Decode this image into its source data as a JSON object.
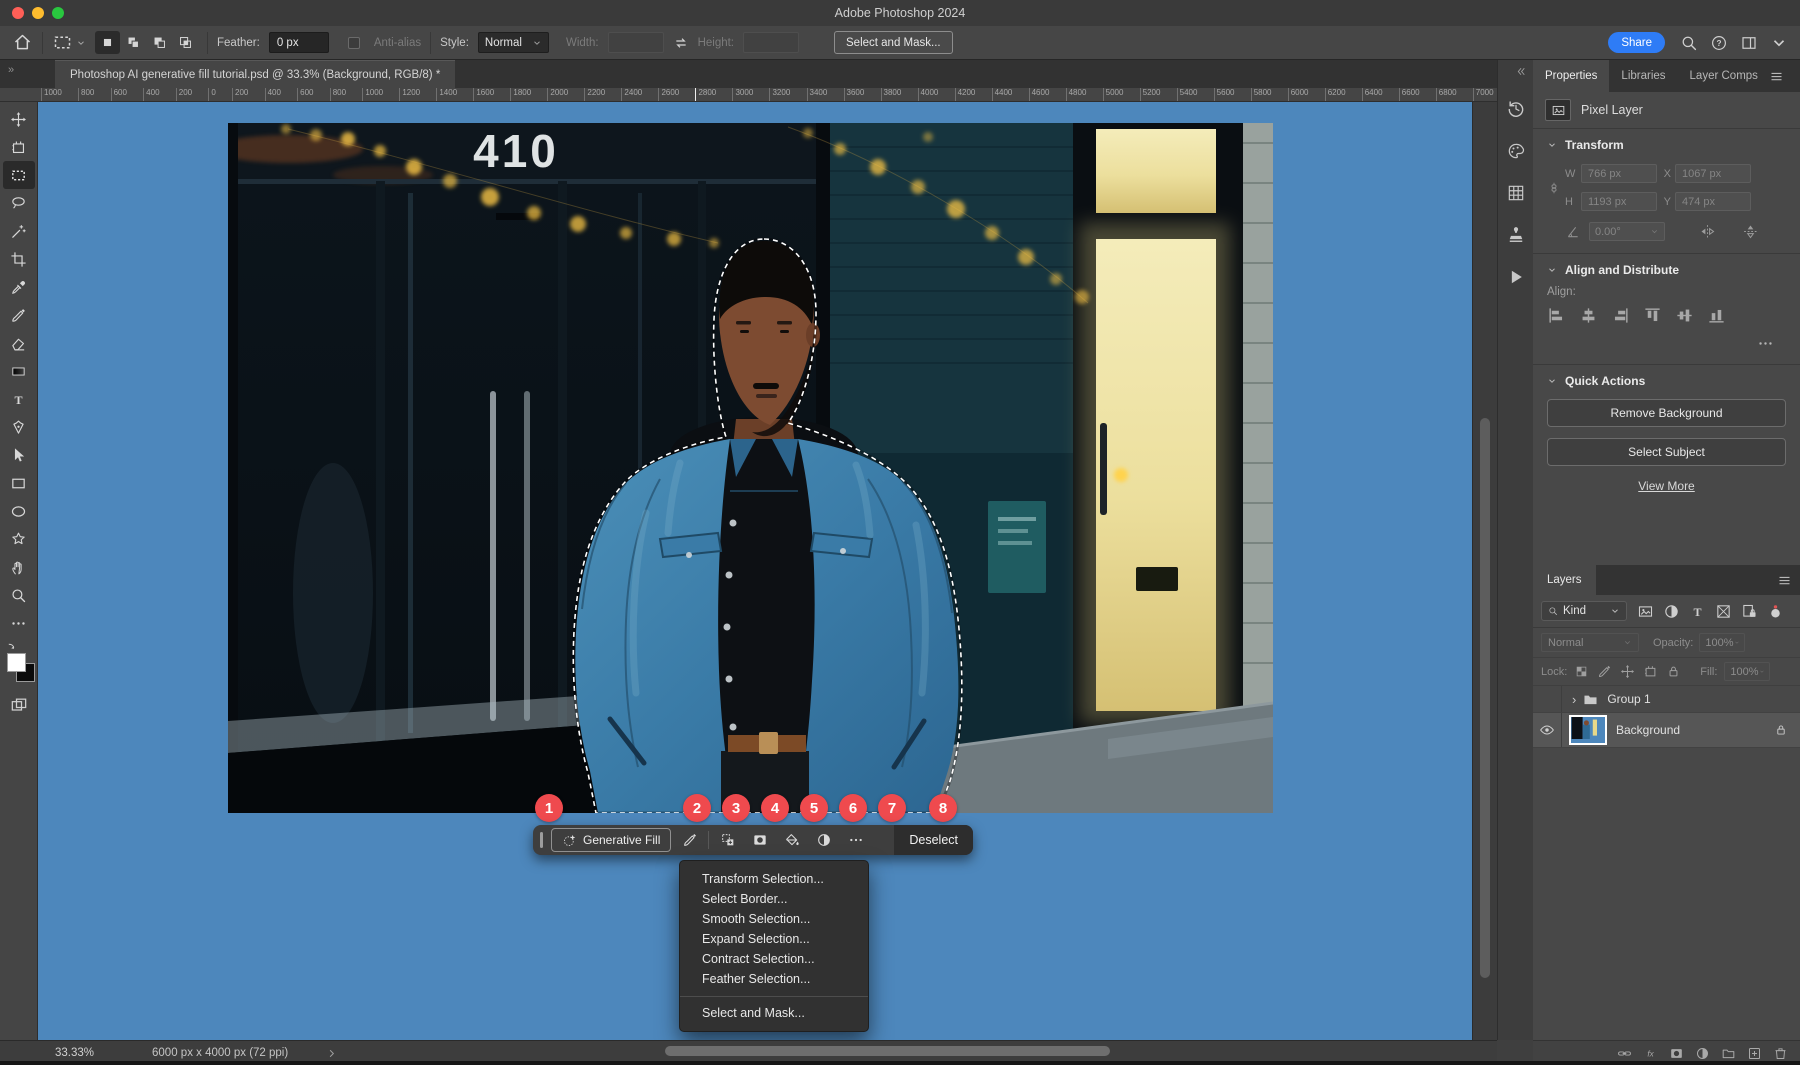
{
  "colors": {
    "canvas_blue": "#4d87bc",
    "badge_red": "#ef4a4e",
    "share_blue": "#2e7cf6"
  },
  "titlebar": {
    "title": "Adobe Photoshop 2024"
  },
  "options_bar": {
    "feather_label": "Feather:",
    "feather_value": "0 px",
    "antialias_label": "Anti-alias",
    "style_label": "Style:",
    "style_value": "Normal",
    "width_label": "Width:",
    "height_label": "Height:",
    "select_and_mask_label": "Select and Mask...",
    "share_label": "Share",
    "right_icons": [
      {
        "name": "search-icon",
        "icon": "#i-zoom"
      },
      {
        "name": "help-icon",
        "icon": "#i-help"
      },
      {
        "name": "workspace-icon",
        "icon": "#i-panel"
      },
      {
        "name": "chevron-down-icon",
        "icon": "#i-chevd"
      }
    ]
  },
  "document_tab": {
    "title": "Photoshop AI generative fill tutorial.psd @ 33.3% (Background, RGB/8) *",
    "overflow_indicator": "»"
  },
  "ruler_labels": [
    "1000",
    "800",
    "600",
    "400",
    "200",
    "0",
    "200",
    "400",
    "600",
    "800",
    "1000",
    "1200",
    "1400",
    "1600",
    "1800",
    "2000",
    "2200",
    "2400",
    "2600",
    "2800",
    "3000",
    "3200",
    "3400",
    "3600",
    "3800",
    "4000",
    "4200",
    "4400",
    "4600",
    "4800",
    "5000",
    "5200",
    "5400",
    "5600",
    "5800",
    "6000",
    "6200",
    "6400",
    "6600",
    "6800",
    "7000"
  ],
  "tools": [
    {
      "name": "move-tool",
      "icon": "#i-move"
    },
    {
      "name": "artboard-tool",
      "icon": "#i-artboard"
    },
    {
      "name": "rectangular-marquee-tool",
      "icon": "#i-marquee",
      "active": true
    },
    {
      "name": "lasso-tool",
      "icon": "#i-lasso"
    },
    {
      "name": "magic-wand-tool",
      "icon": "#i-wand"
    },
    {
      "name": "crop-tool",
      "icon": "#i-crop"
    },
    {
      "name": "eyedropper-tool",
      "icon": "#i-eyedrop"
    },
    {
      "name": "brush-tool",
      "icon": "#i-brush"
    },
    {
      "name": "eraser-tool",
      "icon": "#i-eraser"
    },
    {
      "name": "gradient-tool",
      "icon": "#i-gradient"
    },
    {
      "name": "type-tool",
      "icon": "#i-type"
    },
    {
      "name": "pen-tool",
      "icon": "#i-pen"
    },
    {
      "name": "path-selection-tool",
      "icon": "#i-arrow"
    },
    {
      "name": "rectangle-tool",
      "icon": "#i-rect"
    },
    {
      "name": "ellipse-tool",
      "icon": "#i-ellipse"
    },
    {
      "name": "custom-shape-tool",
      "icon": "#i-star"
    },
    {
      "name": "hand-tool",
      "icon": "#i-hand"
    },
    {
      "name": "zoom-tool",
      "icon": "#i-zoom"
    },
    {
      "name": "edit-toolbar-button",
      "icon": "#i-dots"
    }
  ],
  "canvas": {
    "sign_number": "410"
  },
  "task_bar": {
    "generative_fill_label": "Generative Fill",
    "deselect_label": "Deselect",
    "icons": [
      {
        "name": "modify-selection-icon",
        "icon": "#i-brush"
      },
      {
        "name": "invert-selection-icon",
        "icon": "#i-addsel"
      },
      {
        "name": "create-mask-icon",
        "icon": "#i-mask"
      },
      {
        "name": "fill-selection-icon",
        "icon": "#i-bucket"
      },
      {
        "name": "create-adjustment-icon",
        "icon": "#i-half"
      },
      {
        "name": "more-options-icon",
        "icon": "#i-dots"
      }
    ]
  },
  "badges": [
    "1",
    "2",
    "3",
    "4",
    "5",
    "6",
    "7",
    "8"
  ],
  "context_menu": {
    "items": [
      {
        "label": "Transform Selection..."
      },
      {
        "label": "Select Border..."
      },
      {
        "label": "Smooth Selection..."
      },
      {
        "label": "Expand Selection..."
      },
      {
        "label": "Contract Selection..."
      },
      {
        "label": "Feather Selection..."
      },
      {
        "label": "Select and Mask...",
        "cls": "divided"
      }
    ]
  },
  "status_bar": {
    "zoom_level": "33.33%",
    "doc_info": "6000 px x 4000 px (72 ppi)"
  },
  "collapsed_strip": {
    "icons": [
      {
        "name": "history-panel-icon",
        "icon": "#i-history"
      },
      {
        "name": "swatches-panel-icon",
        "icon": "#i-palette"
      },
      {
        "name": "patterns-panel-icon",
        "icon": "#i-grid"
      },
      {
        "name": "clone-source-panel-icon",
        "icon": "#i-stamp"
      },
      {
        "name": "actions-panel-icon",
        "icon": "#i-play"
      }
    ]
  },
  "properties_panel": {
    "tabs": [
      {
        "label": "Properties",
        "active": true
      },
      {
        "label": "Libraries"
      },
      {
        "label": "Layer Comps"
      }
    ],
    "layer_type": "Pixel Layer",
    "transform": {
      "title": "Transform",
      "w_label": "W",
      "w_value": "766 px",
      "x_label": "X",
      "x_value": "1067 px",
      "h_label": "H",
      "h_value": "1193 px",
      "y_label": "Y",
      "y_value": "474 px",
      "angle_value": "0.00°"
    },
    "align": {
      "title": "Align and Distribute",
      "align_label": "Align:",
      "icons": [
        {
          "name": "align-left-icon",
          "icon": "#i-al-l"
        },
        {
          "name": "align-center-h-icon",
          "icon": "#i-al-c"
        },
        {
          "name": "align-right-icon",
          "icon": "#i-al-r"
        },
        {
          "name": "align-top-icon",
          "icon": "#i-al-t"
        },
        {
          "name": "align-middle-v-icon",
          "icon": "#i-al-m"
        },
        {
          "name": "align-bottom-icon",
          "icon": "#i-al-b"
        }
      ]
    },
    "quick_actions": {
      "title": "Quick Actions",
      "remove_background_label": "Remove Background",
      "select_subject_label": "Select Subject",
      "view_more_label": "View More"
    }
  },
  "layers_panel": {
    "tab": "Layers",
    "filter_kind": "Kind",
    "filter_icons": [
      {
        "name": "filter-pixel-layers-icon",
        "icon": "#i-image"
      },
      {
        "name": "filter-adjustment-layers-icon",
        "icon": "#i-half"
      },
      {
        "name": "filter-type-layers-icon",
        "icon": "#i-type"
      },
      {
        "name": "filter-shape-layers-icon",
        "icon": "#i-frame"
      },
      {
        "name": "filter-smart-objects-icon",
        "icon": "#i-smart"
      },
      {
        "name": "filter-toggle-icon",
        "icon": "#i-toggle"
      }
    ],
    "blend_mode": "Normal",
    "opacity_label": "Opacity:",
    "opacity_value": "100%",
    "lock_label": "Lock:",
    "lock_icons": [
      {
        "name": "lock-transparency-icon",
        "icon": "#i-checker"
      },
      {
        "name": "lock-paint-icon",
        "icon": "#i-brush"
      },
      {
        "name": "lock-position-icon",
        "icon": "#i-move"
      },
      {
        "name": "lock-artboard-icon",
        "icon": "#i-artboard"
      },
      {
        "name": "lock-all-icon",
        "icon": "#i-lock"
      }
    ],
    "fill_label": "Fill:",
    "fill_value": "100%",
    "group_expander": "›",
    "group_name": "Group 1",
    "background_name": "Background",
    "footer_icons": [
      {
        "name": "link-layers-icon",
        "icon": "#i-chain"
      },
      {
        "name": "layer-style-icon",
        "icon": "#i-fx"
      },
      {
        "name": "add-layer-mask-icon",
        "icon": "#i-mask"
      },
      {
        "name": "new-adjustment-layer-icon",
        "icon": "#i-half"
      },
      {
        "name": "new-group-icon",
        "icon": "#i-folder"
      },
      {
        "name": "new-layer-icon",
        "icon": "#i-plussq"
      },
      {
        "name": "delete-layer-icon",
        "icon": "#i-trash"
      }
    ]
  }
}
